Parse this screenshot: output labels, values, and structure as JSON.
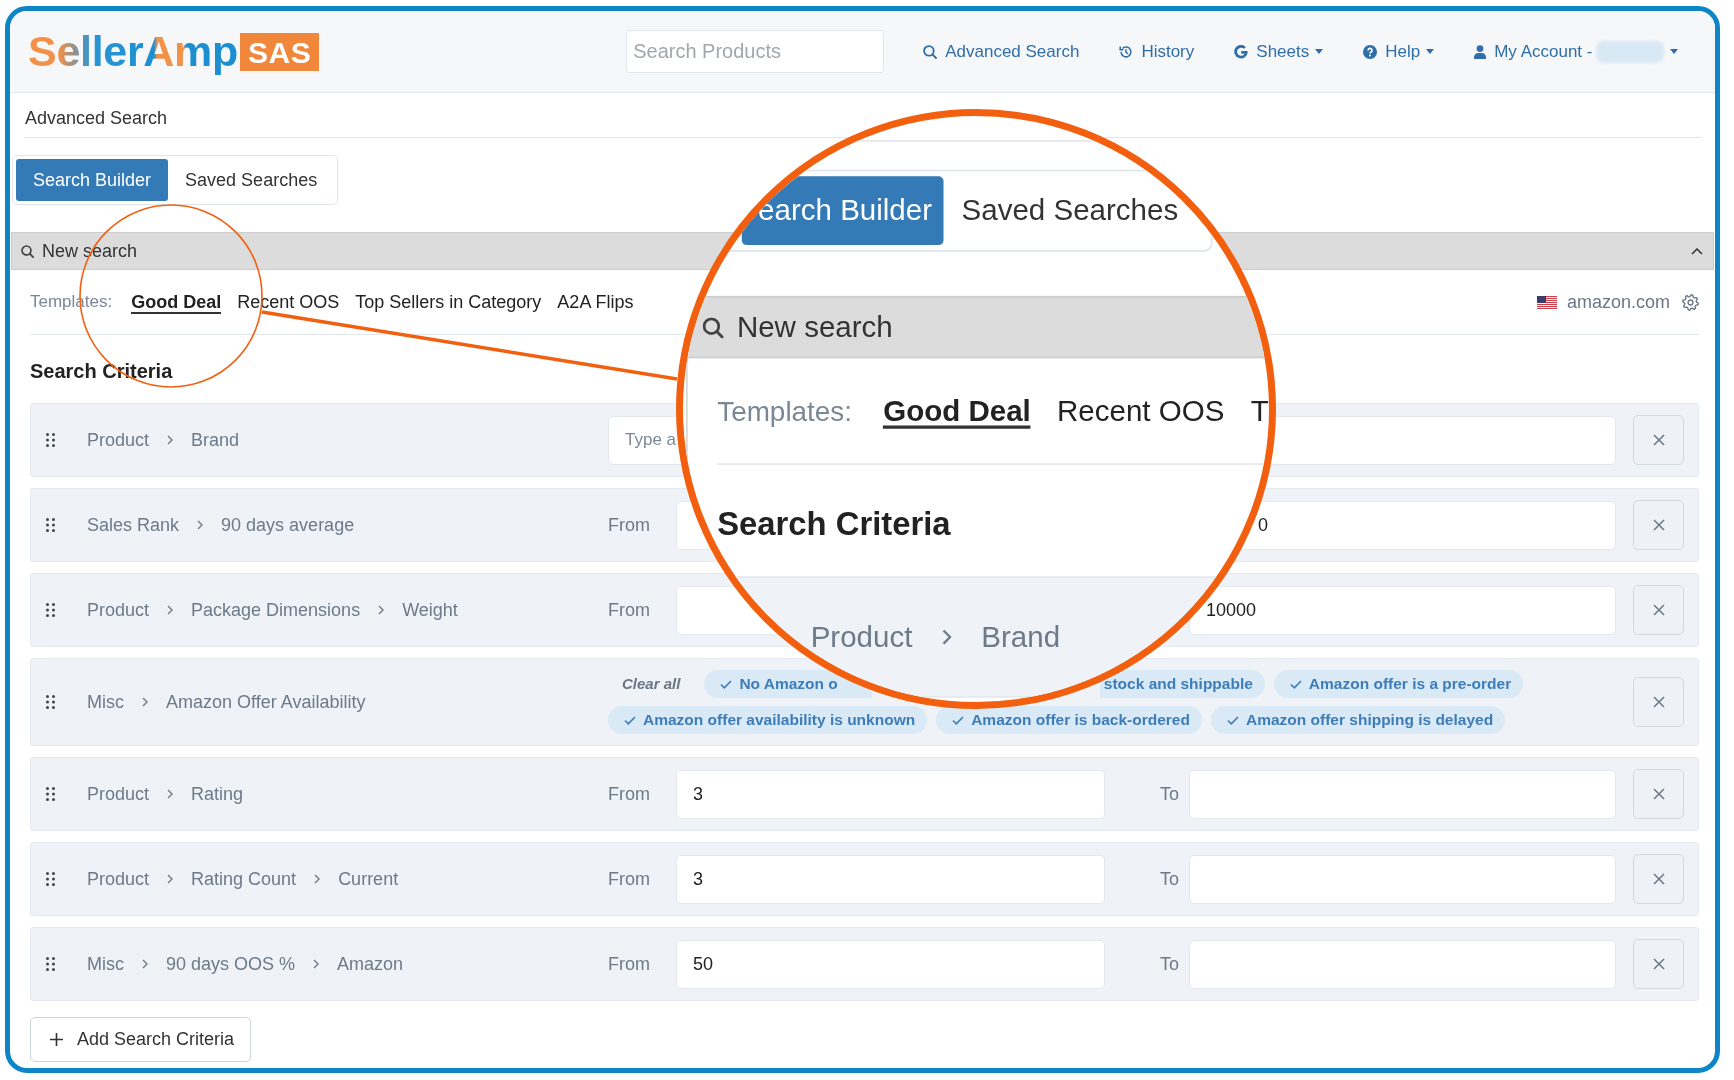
{
  "header": {
    "logo": {
      "text": "SellerAmp",
      "badge": "SAS"
    },
    "search": {
      "placeholder": "Search Products"
    },
    "nav": [
      {
        "label": "Advanced Search",
        "dropdown": false,
        "name_blurred": false
      },
      {
        "label": "History",
        "dropdown": false,
        "name_blurred": false
      },
      {
        "label": "Sheets",
        "dropdown": true,
        "name_blurred": false
      },
      {
        "label": "Help",
        "dropdown": true,
        "name_blurred": false
      },
      {
        "label": "My Account -",
        "dropdown": true,
        "name_blurred": true
      }
    ]
  },
  "page_title": "Advanced Search",
  "tabs": [
    {
      "label": "Search Builder",
      "selected": true
    },
    {
      "label": "Saved Searches",
      "selected": false
    }
  ],
  "panel": {
    "title": "New search",
    "expanded": true,
    "templates": {
      "label": "Templates:",
      "items": [
        {
          "label": "Good Deal",
          "selected": true
        },
        {
          "label": "Recent OOS",
          "selected": false
        },
        {
          "label": "Top Sellers in Category",
          "selected": false
        },
        {
          "label": "A2A Flips",
          "selected": false
        }
      ]
    },
    "marketplace": "amazon.com",
    "section_title": "Search Criteria",
    "criteria": [
      {
        "kind": "text",
        "path": [
          "Product",
          "Brand"
        ],
        "placeholder": "Type a"
      },
      {
        "kind": "range",
        "path": [
          "Sales Rank",
          "90 days average"
        ],
        "from_label": "From",
        "to_value": "0"
      },
      {
        "kind": "range",
        "path": [
          "Product",
          "Package Dimensions",
          "Weight"
        ],
        "from_label": "From",
        "to_value": "10000"
      },
      {
        "kind": "options",
        "path": [
          "Misc",
          "Amazon Offer Availability"
        ],
        "clear_label": "Clear all",
        "options": [
          "No Amazon o",
          "stock and shippable",
          "Amazon offer is a pre-order",
          "Amazon offer availability is unknown",
          "Amazon offer is back-ordered",
          "Amazon offer shipping is delayed"
        ]
      },
      {
        "kind": "range",
        "path": [
          "Product",
          "Rating"
        ],
        "from_label": "From",
        "from_value": "3",
        "to_label": "To"
      },
      {
        "kind": "range",
        "path": [
          "Product",
          "Rating Count",
          "Current"
        ],
        "from_label": "From",
        "from_value": "3",
        "to_label": "To"
      },
      {
        "kind": "range",
        "path": [
          "Misc",
          "90 days OOS %",
          "Amazon"
        ],
        "from_label": "From",
        "from_value": "50",
        "to_label": "To"
      }
    ],
    "add_button": "Add Search Criteria"
  },
  "magnifier": {
    "tabs": [
      {
        "label": "earch Builder",
        "selected": true
      },
      {
        "label": "Saved Searches",
        "selected": false
      }
    ],
    "panel_title": "New search",
    "templates_label": "Templates:",
    "templates": [
      {
        "label": "Good Deal",
        "selected": true
      },
      {
        "label": "Recent OOS",
        "selected": false
      },
      {
        "label": "T",
        "selected": false
      }
    ],
    "section_title": "Search Criteria",
    "path": [
      "Product",
      "Brand"
    ]
  }
}
